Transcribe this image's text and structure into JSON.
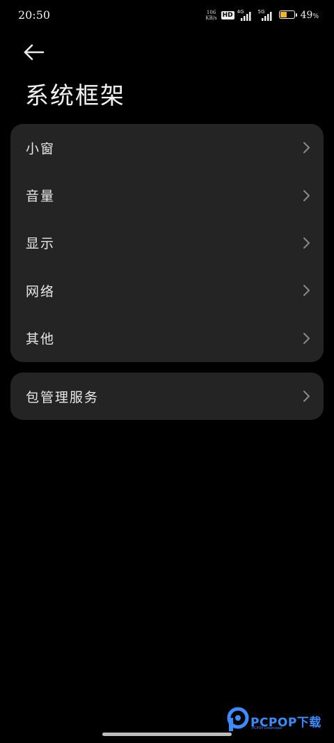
{
  "status_bar": {
    "time": "20:50",
    "net_speed_value": "106",
    "net_speed_unit": "KB/s",
    "hd_badge": "HD",
    "signal_1_label": "4G",
    "signal_2_label": "5G",
    "battery_percent": "49",
    "battery_suffix": "%",
    "battery_color": "#f2b42a"
  },
  "header": {
    "back_icon": "arrow-left-icon",
    "title": "系统框架"
  },
  "group_main": {
    "items": [
      {
        "label": "小窗"
      },
      {
        "label": "音量"
      },
      {
        "label": "显示"
      },
      {
        "label": "网络"
      },
      {
        "label": "其他"
      }
    ]
  },
  "group_secondary": {
    "items": [
      {
        "label": "包管理服务"
      }
    ]
  },
  "watermark": {
    "brand": "PCPOP下载",
    "sub": "PCPOP Download"
  },
  "colors": {
    "background": "#000000",
    "card": "#242424",
    "accent_watermark": "#3d8bff"
  }
}
